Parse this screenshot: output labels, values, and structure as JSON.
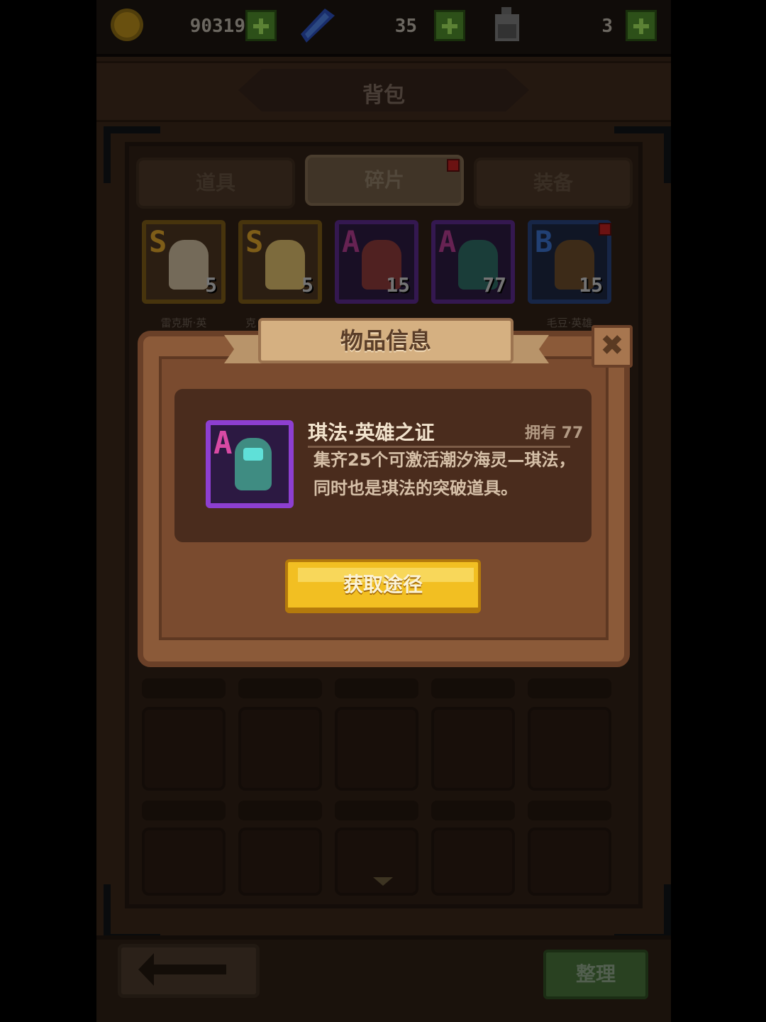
{
  "currency": {
    "gold": "90319",
    "gems": "35",
    "potions": "3"
  },
  "header": {
    "title": "背包"
  },
  "tabs": [
    {
      "label": "道具",
      "active": false
    },
    {
      "label": "碎片",
      "active": true,
      "badge": true
    },
    {
      "label": "装备",
      "active": false
    }
  ],
  "cards": [
    {
      "rank": "S",
      "count": "5",
      "label": "雷克斯·英",
      "color": "#c08a1e"
    },
    {
      "rank": "S",
      "count": "5",
      "label": "克",
      "color": "#c08a1e"
    },
    {
      "rank": "A",
      "count": "15",
      "label": "",
      "color": "#8d3fd0"
    },
    {
      "rank": "A",
      "count": "77",
      "label": "",
      "color": "#8d3fd0"
    },
    {
      "rank": "B",
      "count": "15",
      "label": "毛豆·英雄",
      "color": "#3a6fc8",
      "badge": true
    }
  ],
  "dialog": {
    "title": "物品信息",
    "close": "✖",
    "item": {
      "rank": "A",
      "name": "琪法·英雄之证",
      "owned": "拥有 77",
      "description": "集齐25个可激活潮汐海灵—琪法，同时也是琪法的突破道具。"
    },
    "action_label": "获取途径"
  },
  "bottom": {
    "sort_label": "整理"
  },
  "colors": {
    "accent_gold": "#f2bf22",
    "rank_a_purple": "#8d3fd0",
    "plus_green": "#4e8a2c"
  },
  "icons": {
    "gold": "gold-coin-icon",
    "gem": "blue-crystal-icon",
    "potion": "potion-bottle-icon",
    "back": "left-arrow-icon",
    "scroll": "chevron-down-icon"
  }
}
